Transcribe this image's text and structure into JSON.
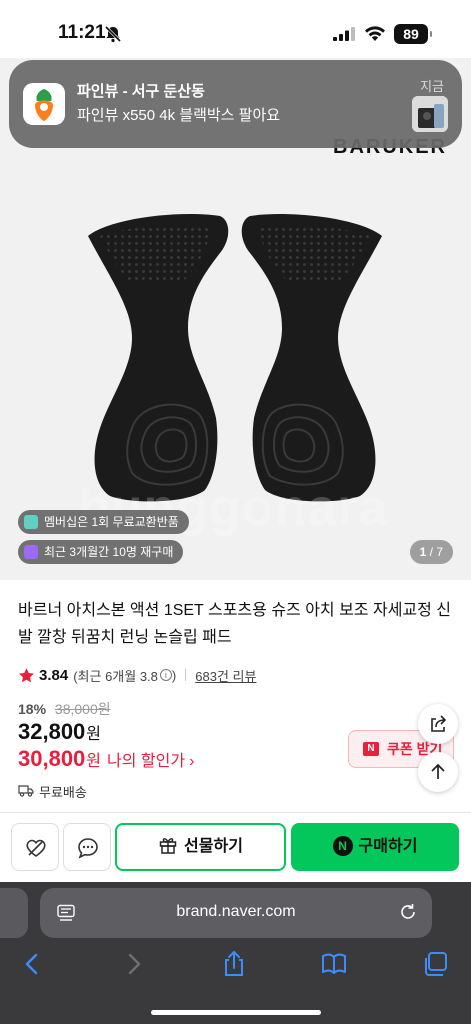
{
  "status_bar": {
    "time": "11:21",
    "battery": "89"
  },
  "notification": {
    "title": "파인뷰 - 서구 둔산동",
    "body": "파인뷰 x550 4k 블랙박스 팔아요",
    "time": "지금"
  },
  "product_image": {
    "brand": "BARUKER",
    "watermark": "bunggonara",
    "badges": [
      {
        "label": "멤버십은 1회 무료교환반품",
        "icon": "membership-icon"
      },
      {
        "label": "최근 3개월간 10명 재구매",
        "icon": "repurchase-icon"
      }
    ],
    "page_current": "1",
    "page_total": "/ 7"
  },
  "product": {
    "title": "바르너 아치스본 액션 1SET 스포츠용 슈즈 아치 보조 자세교정 신발 깔창 뒤꿈치 런닝 논슬립 패드",
    "rating": "3.84",
    "rating_recent": "(최근 6개월 3.8",
    "rating_recent_close": ")",
    "review_count": "683건 리뷰",
    "discount_rate": "18%",
    "original_price": "38,000원",
    "price": "32,800",
    "price_unit": "원",
    "my_price": "30,800",
    "my_price_unit": "원",
    "my_price_label": "나의 할인가",
    "shipping": "무료배송",
    "coupon_label": "쿠폰 받기",
    "coupon_mark": "N"
  },
  "action_bar": {
    "gift_label": "선물하기",
    "buy_label": "구매하기",
    "buy_mark": "N"
  },
  "browser": {
    "url": "brand.naver.com"
  },
  "colors": {
    "naver_green": "#03c75a",
    "sale_red": "#e8203b",
    "safari_bg": "#3a3a3c"
  }
}
